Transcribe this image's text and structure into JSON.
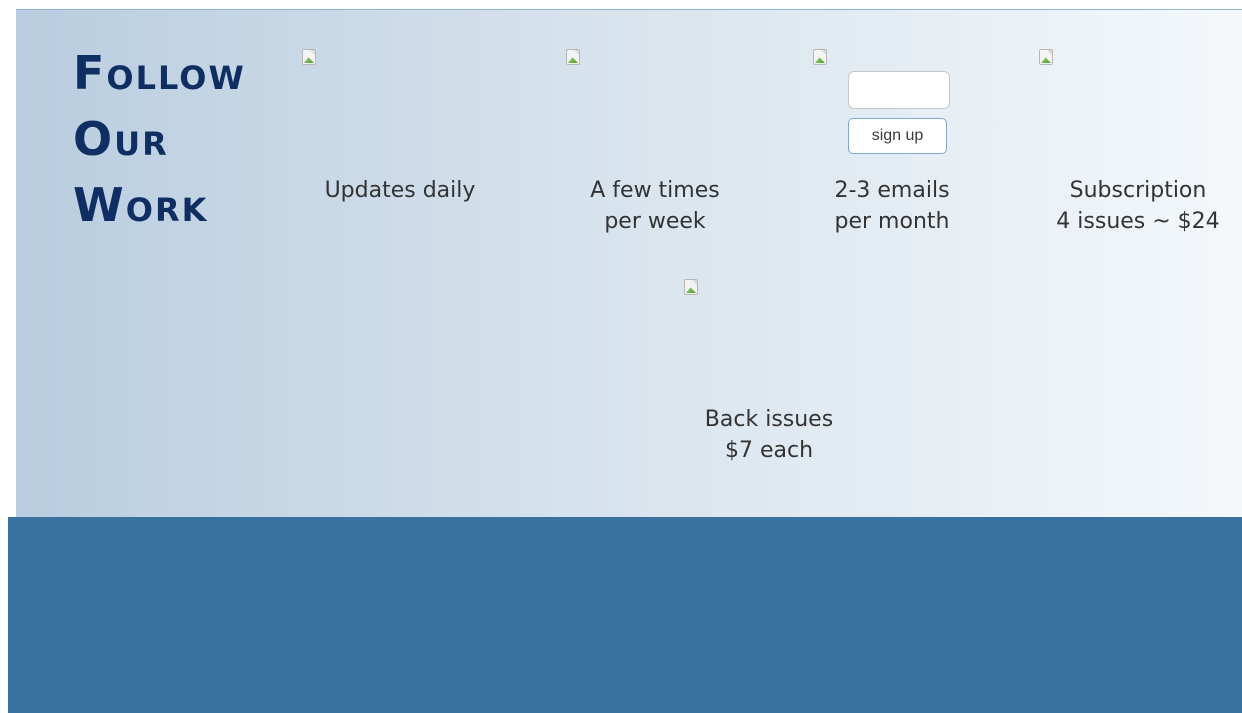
{
  "follow": {
    "heading_lines": [
      "Follow",
      "Our",
      "Work"
    ],
    "items": [
      {
        "lines": [
          "Updates daily"
        ]
      },
      {
        "lines": [
          "A few times",
          "per week"
        ]
      },
      {
        "lines": [
          "2-3 emails",
          "per month"
        ]
      },
      {
        "lines": [
          "Subscription",
          "4 issues ~ $24"
        ]
      },
      {
        "lines": [
          "Back issues",
          "$7 each"
        ]
      }
    ],
    "newsletter": {
      "input_value": "",
      "input_placeholder": "",
      "signup_label": "sign up"
    }
  },
  "colors": {
    "heading": "#0f2f63",
    "footer_band": "#3a729f",
    "button_border": "#7fa7d7"
  },
  "icons": [
    "broken-image-icon"
  ]
}
